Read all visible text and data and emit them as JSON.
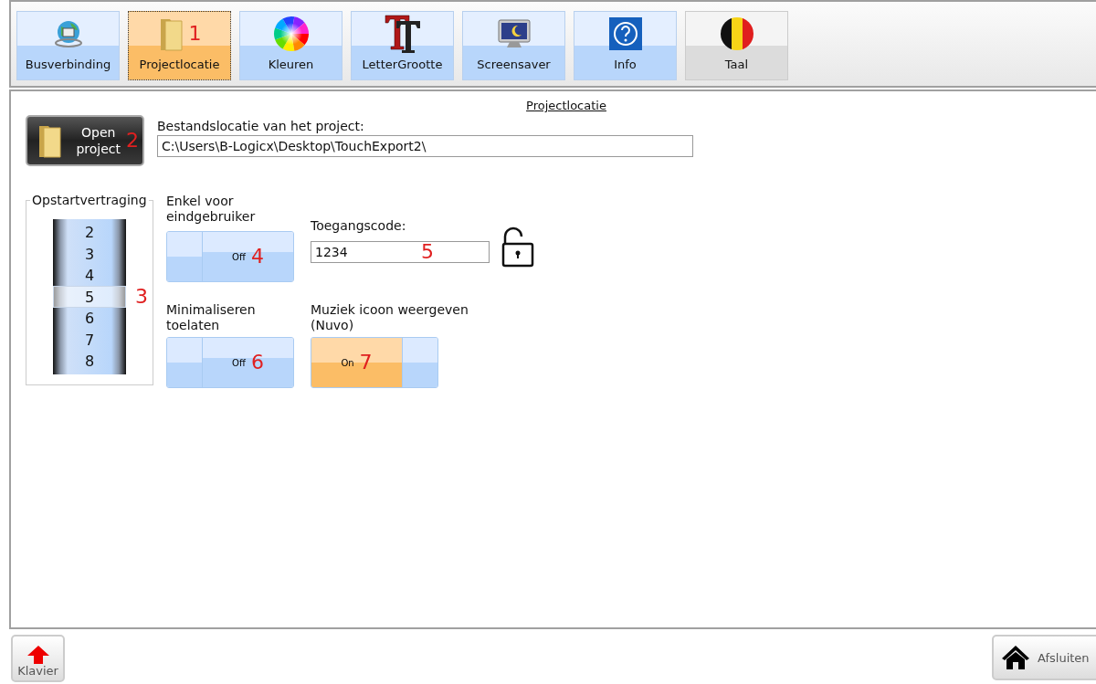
{
  "tabs": [
    {
      "label": "Busverbinding",
      "kind": "globe",
      "selected": false
    },
    {
      "label": "Projectlocatie",
      "kind": "folder",
      "selected": true,
      "callout": "1"
    },
    {
      "label": "Kleuren",
      "kind": "colorwheel",
      "selected": false
    },
    {
      "label": "LetterGrootte",
      "kind": "letters",
      "selected": false
    },
    {
      "label": "Screensaver",
      "kind": "monitor",
      "selected": false
    },
    {
      "label": "Info",
      "kind": "help",
      "selected": false
    },
    {
      "label": "Taal",
      "kind": "flag",
      "selected": false
    }
  ],
  "section_title": "Projectlocatie",
  "open_button": {
    "label_lines": [
      "Open",
      "project"
    ],
    "callout": "2"
  },
  "project_path": {
    "label": "Bestandslocatie van het project:",
    "value": "C:\\Users\\B-Logicx\\Desktop\\TouchExport2\\"
  },
  "startup_delay": {
    "title": "Opstartvertraging",
    "callout": "3",
    "items": [
      {
        "label": "2",
        "selected": false
      },
      {
        "label": "3",
        "selected": false
      },
      {
        "label": "4",
        "selected": false
      },
      {
        "label": "5",
        "selected": true
      },
      {
        "label": "6",
        "selected": false
      },
      {
        "label": "7",
        "selected": false
      },
      {
        "label": "8",
        "selected": false
      }
    ]
  },
  "end_user_only": {
    "label_lines": [
      "Enkel voor",
      "eindgebruiker"
    ],
    "on": false,
    "state_text": "Off",
    "callout": "4"
  },
  "access_code": {
    "label": "Toegangscode:",
    "value": "1234",
    "callout": "5"
  },
  "allow_minimize": {
    "label_lines": [
      "Minimaliseren",
      "toelaten"
    ],
    "on": false,
    "state_text": "Off",
    "callout": "6"
  },
  "music_icon": {
    "label_lines": [
      "Muziek icoon weergeven",
      "(Nuvo)"
    ],
    "on": true,
    "state_text": "On",
    "callout": "7"
  },
  "footer": {
    "keyboard": "Klavier",
    "close": "Afsluiten"
  }
}
